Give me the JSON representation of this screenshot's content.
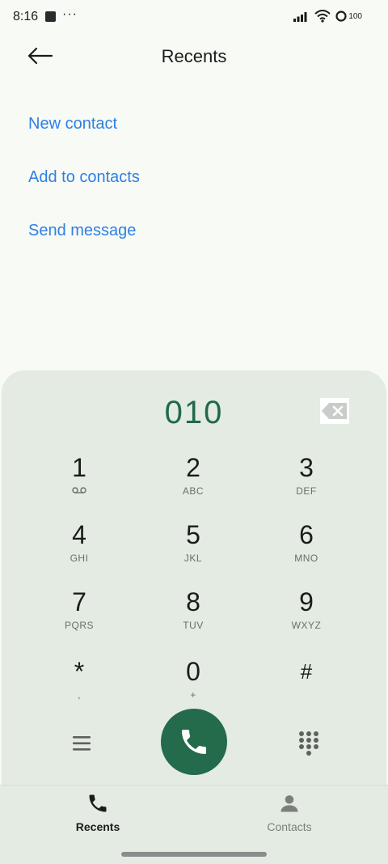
{
  "status_bar": {
    "time": "8:16",
    "dots": "···",
    "battery": "100"
  },
  "header": {
    "title": "Recents",
    "back_icon": "arrow-left-icon"
  },
  "actions": {
    "new_contact": "New contact",
    "add_to_contacts": "Add to contacts",
    "send_message": "Send message"
  },
  "dialpad": {
    "entered_number": "010",
    "keys": [
      {
        "digit": "1",
        "letters": "voicemail-icon"
      },
      {
        "digit": "2",
        "letters": "ABC"
      },
      {
        "digit": "3",
        "letters": "DEF"
      },
      {
        "digit": "4",
        "letters": "GHI"
      },
      {
        "digit": "5",
        "letters": "JKL"
      },
      {
        "digit": "6",
        "letters": "MNO"
      },
      {
        "digit": "7",
        "letters": "PQRS"
      },
      {
        "digit": "8",
        "letters": "TUV"
      },
      {
        "digit": "9",
        "letters": "WXYZ"
      },
      {
        "digit": "*",
        "letters": ","
      },
      {
        "digit": "0",
        "letters": "+"
      },
      {
        "digit": "#",
        "letters": ""
      }
    ]
  },
  "bottom_nav": {
    "recents": "Recents",
    "contacts": "Contacts"
  },
  "colors": {
    "accent_link": "#2f7fe6",
    "call_green": "#236b4a",
    "number_green": "#226a47",
    "panel_bg": "#e3ebe2"
  }
}
